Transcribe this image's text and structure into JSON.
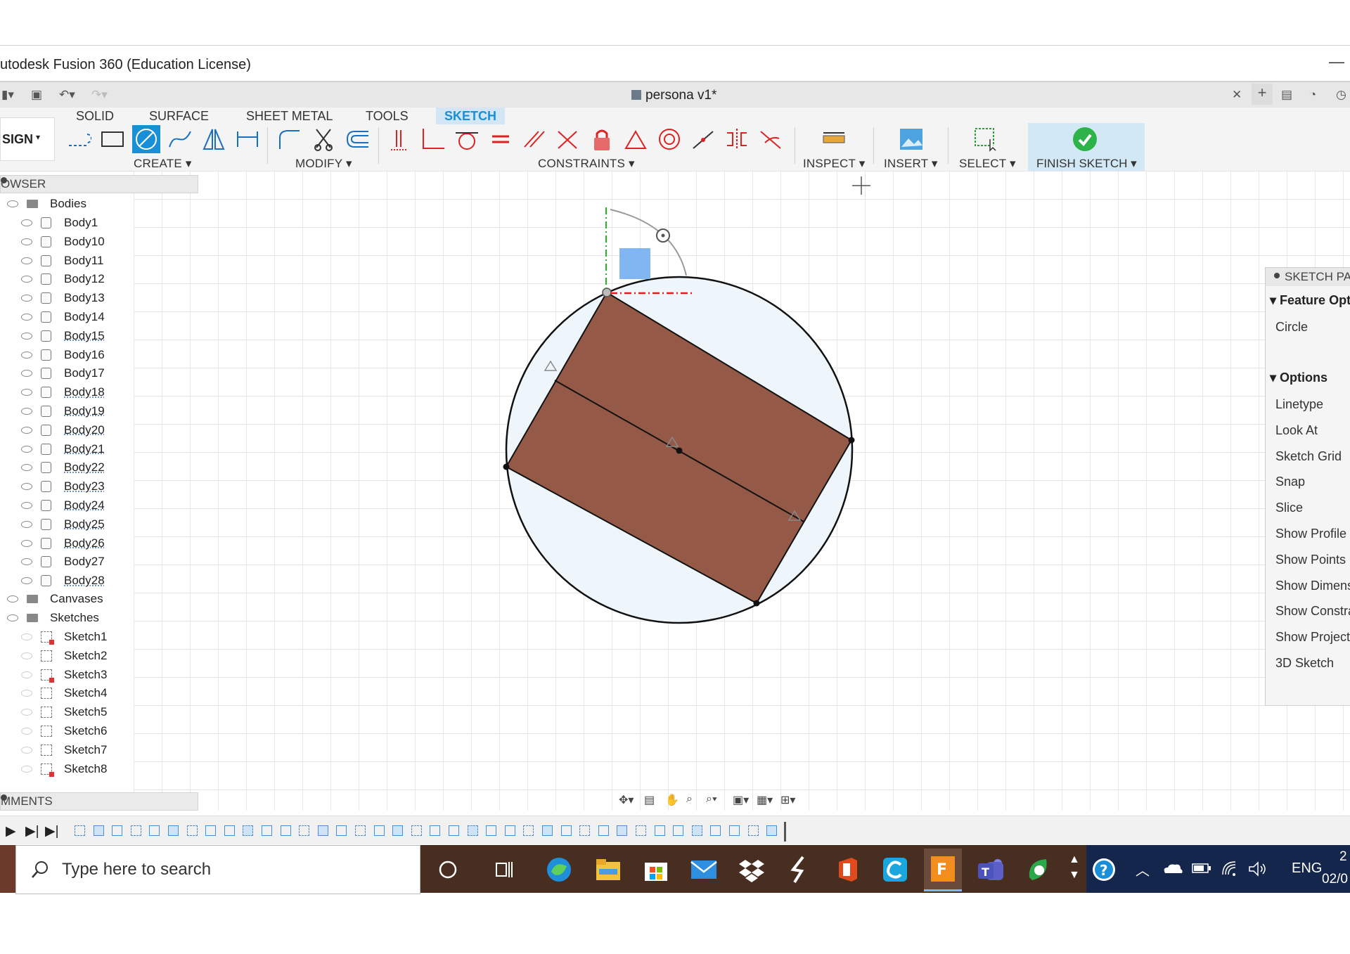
{
  "window": {
    "title": "utodesk Fusion 360 (Education License)",
    "document": "persona v1*"
  },
  "ribbon": {
    "tabs": [
      "SOLID",
      "SURFACE",
      "SHEET METAL",
      "TOOLS",
      "SKETCH"
    ],
    "workspace": "SIGN",
    "groups": {
      "create": "CREATE",
      "modify": "MODIFY",
      "constraints": "CONSTRAINTS",
      "inspect": "INSPECT",
      "insert": "INSERT",
      "select": "SELECT",
      "finish": "FINISH SKETCH"
    }
  },
  "browser": {
    "title": "OWSER",
    "bodies_label": "Bodies",
    "bodies": [
      "Body1",
      "Body10",
      "Body11",
      "Body12",
      "Body13",
      "Body14",
      "Body15",
      "Body16",
      "Body17",
      "Body18",
      "Body19",
      "Body20",
      "Body21",
      "Body22",
      "Body23",
      "Body24",
      "Body25",
      "Body26",
      "Body27",
      "Body28"
    ],
    "canvases_label": "Canvases",
    "sketches_label": "Sketches",
    "sketches": [
      "Sketch1",
      "Sketch2",
      "Sketch3",
      "Sketch4",
      "Sketch5",
      "Sketch6",
      "Sketch7",
      "Sketch8"
    ]
  },
  "comments": {
    "title": "MMENTS"
  },
  "palette": {
    "title": "SKETCH PA",
    "feature_section": "Feature Opti",
    "feature_item": "Circle",
    "options_section": "Options",
    "options": [
      "Linetype",
      "Look At",
      "Sketch Grid",
      "Snap",
      "Slice",
      "Show Profile",
      "Show Points",
      "Show Dimens",
      "Show Constra",
      "Show Projecte",
      "3D Sketch"
    ]
  },
  "taskbar": {
    "search_placeholder": "Type here to search",
    "lang": "ENG",
    "clock_time": "2",
    "clock_date": "02/0"
  },
  "colors": {
    "accent": "#1a8fd8",
    "profile_fill": "#955a47",
    "taskbar": "#472e21",
    "tray": "#14264b",
    "finish": "#2db34a"
  }
}
